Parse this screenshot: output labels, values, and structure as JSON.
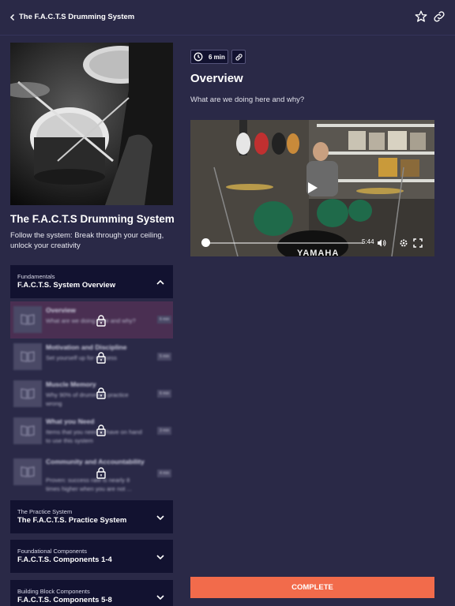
{
  "header": {
    "title": "The F.A.C.T.S Drumming System"
  },
  "course": {
    "title": "The F.A.C.T.S Drumming System",
    "subtitle": "Follow the system: Break through your ceiling, unlock your creativity"
  },
  "sections": [
    {
      "eyebrow": "Fundamentals",
      "name": "F.A.C.T.S. System Overview",
      "expanded": true
    },
    {
      "eyebrow": "The Practice System",
      "name": "The F.A.C.T.S. Practice System",
      "expanded": false
    },
    {
      "eyebrow": "Foundational Components",
      "name": "F.A.C.T.S. Components 1-4",
      "expanded": false
    },
    {
      "eyebrow": "Building Block Components",
      "name": "F.A.C.T.S. Components 5-8",
      "expanded": false
    }
  ],
  "lessons": [
    {
      "title": "Overview",
      "desc": "What are we doing here and why?",
      "duration": "6 min",
      "locked": true
    },
    {
      "title": "Motivation and Discipline",
      "desc": "Set yourself up for success",
      "duration": "5 min",
      "locked": true
    },
    {
      "title": "Muscle Memory",
      "desc": "Why 90% of drummers practice wrong",
      "duration": "6 min",
      "locked": true
    },
    {
      "title": "What you Need",
      "desc": "Items that you need to have on hand to use this system",
      "duration": "3 min",
      "locked": true
    },
    {
      "title": "Community and Accountability",
      "desc": "Proven: success rate is nearly 8 times higher when you are not ...",
      "duration": "4 min",
      "locked": true
    }
  ],
  "lesson_detail": {
    "duration": "6 min",
    "heading": "Overview",
    "subheading": "What are we doing here and why?"
  },
  "video": {
    "time_remaining": "5:44",
    "progress_fraction": 0.0,
    "brand_text": "YAMAHA"
  },
  "actions": {
    "complete_label": "COMPLETE"
  },
  "colors": {
    "background": "#2a2947",
    "panel": "#121230",
    "accent": "#f26b4b"
  }
}
